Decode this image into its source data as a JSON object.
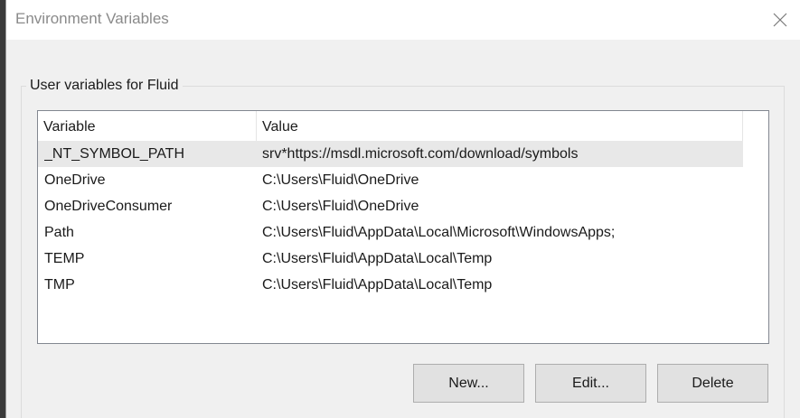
{
  "window": {
    "title": "Environment Variables"
  },
  "user_variables": {
    "group_label": "User variables for Fluid",
    "columns": [
      "Variable",
      "Value"
    ],
    "rows": [
      {
        "variable": "_NT_SYMBOL_PATH",
        "value": "srv*https://msdl.microsoft.com/download/symbols"
      },
      {
        "variable": "OneDrive",
        "value": "C:\\Users\\Fluid\\OneDrive"
      },
      {
        "variable": "OneDriveConsumer",
        "value": "C:\\Users\\Fluid\\OneDrive"
      },
      {
        "variable": "Path",
        "value": "C:\\Users\\Fluid\\AppData\\Local\\Microsoft\\WindowsApps;"
      },
      {
        "variable": "TEMP",
        "value": "C:\\Users\\Fluid\\AppData\\Local\\Temp"
      },
      {
        "variable": "TMP",
        "value": "C:\\Users\\Fluid\\AppData\\Local\\Temp"
      }
    ],
    "selected_row": 0
  },
  "buttons": {
    "new_label": "New...",
    "edit_label": "Edit...",
    "delete_label": "Delete"
  },
  "icons": {
    "close": "close-icon"
  }
}
